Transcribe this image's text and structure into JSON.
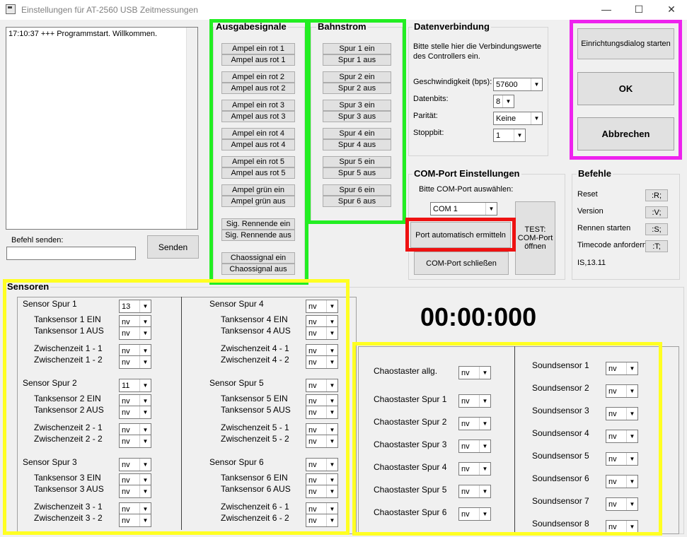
{
  "window": {
    "title": "Einstellungen für AT-2560 USB Zeitmessungen",
    "minimize": "—",
    "maximize": "☐",
    "close": "✕"
  },
  "log": {
    "lines": [
      "17:10:37 +++ Programmstart. Willkommen."
    ]
  },
  "befehl": {
    "label": "Befehl senden:",
    "value": "",
    "send": "Senden"
  },
  "ausgabe": {
    "title": "Ausgabesignale",
    "buttons": [
      "Ampel ein rot 1",
      "Ampel aus rot 1",
      "Ampel ein rot 2",
      "Ampel aus rot 2",
      "Ampel ein rot 3",
      "Ampel aus rot 3",
      "Ampel ein rot 4",
      "Ampel aus rot 4",
      "Ampel ein rot 5",
      "Ampel aus rot 5",
      "Ampel grün ein",
      "Ampel grün aus",
      "Sig. Rennende ein",
      "Sig. Rennende aus",
      "Chaossignal ein",
      "Chaossignal aus"
    ]
  },
  "bahnstrom": {
    "title": "Bahnstrom",
    "buttons": [
      "Spur 1 ein",
      "Spur 1 aus",
      "Spur 2 ein",
      "Spur 2 aus",
      "Spur 3 ein",
      "Spur 3 aus",
      "Spur 4 ein",
      "Spur 4 aus",
      "Spur 5 ein",
      "Spur 5 aus",
      "Spur 6 ein",
      "Spur 6 aus"
    ]
  },
  "daten": {
    "title": "Datenverbindung",
    "hint": [
      "Bitte stelle hier die Verbindungswerte",
      "des Controllers ein."
    ],
    "rows": [
      {
        "label": "Geschwindigkeit (bps):",
        "value": "57600"
      },
      {
        "label": "Datenbits:",
        "value": "8"
      },
      {
        "label": "Parität:",
        "value": "Keine"
      },
      {
        "label": "Stoppbit:",
        "value": "1"
      }
    ]
  },
  "com": {
    "title": "COM-Port Einstellungen",
    "hint": "Bitte COM-Port auswählen:",
    "port": "COM 1",
    "auto": "Port automatisch ermitteln",
    "close": "COM-Port schließen",
    "test": [
      "TEST:",
      "COM-Port",
      "öffnen"
    ]
  },
  "actions": {
    "setup": "Einrichtungsdialog starten",
    "ok": "OK",
    "cancel": "Abbrechen"
  },
  "befehle": {
    "title": "Befehle",
    "rows": [
      {
        "label": "Reset",
        "code": ":R;"
      },
      {
        "label": "Version",
        "code": ":V;"
      },
      {
        "label": "Rennen starten",
        "code": ":S;"
      },
      {
        "label": "Timecode anfordern",
        "code": ":T;"
      }
    ],
    "version": "IS,13.11"
  },
  "sensoren": {
    "title": "Sensoren",
    "left": [
      {
        "head": "Sensor Spur 1",
        "head_val": "13",
        "items": [
          [
            "Tanksensor 1 EIN",
            "nv"
          ],
          [
            "Tanksensor 1 AUS",
            "nv"
          ],
          [
            "Zwischenzeit 1 - 1",
            "nv"
          ],
          [
            "Zwischenzeit 1 - 2",
            "nv"
          ]
        ]
      },
      {
        "head": "Sensor Spur 2",
        "head_val": "11",
        "items": [
          [
            "Tanksensor 2 EIN",
            "nv"
          ],
          [
            "Tanksensor 2 AUS",
            "nv"
          ],
          [
            "Zwischenzeit 2 - 1",
            "nv"
          ],
          [
            "Zwischenzeit 2 - 2",
            "nv"
          ]
        ]
      },
      {
        "head": "Sensor Spur 3",
        "head_val": "nv",
        "items": [
          [
            "Tanksensor 3 EIN",
            "nv"
          ],
          [
            "Tanksensor 3 AUS",
            "nv"
          ],
          [
            "Zwischenzeit 3 - 1",
            "nv"
          ],
          [
            "Zwischenzeit 3 - 2",
            "nv"
          ]
        ]
      }
    ],
    "right": [
      {
        "head": "Sensor Spur 4",
        "head_val": "nv",
        "items": [
          [
            "Tanksensor 4 EIN",
            "nv"
          ],
          [
            "Tanksensor 4 AUS",
            "nv"
          ],
          [
            "Zwischenzeit 4 - 1",
            "nv"
          ],
          [
            "Zwischenzeit 4 - 2",
            "nv"
          ]
        ]
      },
      {
        "head": "Sensor Spur 5",
        "head_val": "nv",
        "items": [
          [
            "Tanksensor 5 EIN",
            "nv"
          ],
          [
            "Tanksensor 5 AUS",
            "nv"
          ],
          [
            "Zwischenzeit 5 - 1",
            "nv"
          ],
          [
            "Zwischenzeit 5 - 2",
            "nv"
          ]
        ]
      },
      {
        "head": "Sensor Spur 6",
        "head_val": "nv",
        "items": [
          [
            "Tanksensor 6 EIN",
            "nv"
          ],
          [
            "Tanksensor 6 AUS",
            "nv"
          ],
          [
            "Zwischenzeit 6 - 1",
            "nv"
          ],
          [
            "Zwischenzeit 6 - 2",
            "nv"
          ]
        ]
      }
    ]
  },
  "timer": "00:00:000",
  "chaos": [
    [
      "Chaostaster allg.",
      "nv"
    ],
    [
      "Chaostaster Spur 1",
      "nv"
    ],
    [
      "Chaostaster Spur 2",
      "nv"
    ],
    [
      "Chaostaster Spur 3",
      "nv"
    ],
    [
      "Chaostaster Spur 4",
      "nv"
    ],
    [
      "Chaostaster Spur 5",
      "nv"
    ],
    [
      "Chaostaster Spur 6",
      "nv"
    ]
  ],
  "sound": [
    [
      "Soundsensor 1",
      "nv"
    ],
    [
      "Soundsensor 2",
      "nv"
    ],
    [
      "Soundsensor 3",
      "nv"
    ],
    [
      "Soundsensor 4",
      "nv"
    ],
    [
      "Soundsensor 5",
      "nv"
    ],
    [
      "Soundsensor 6",
      "nv"
    ],
    [
      "Soundsensor 7",
      "nv"
    ],
    [
      "Soundsensor 8",
      "nv"
    ]
  ],
  "colors": {
    "highlight_green": "#22ee22",
    "highlight_yellow": "#ffff22",
    "highlight_magenta": "#ee22ee",
    "highlight_red": "#ee1111"
  }
}
